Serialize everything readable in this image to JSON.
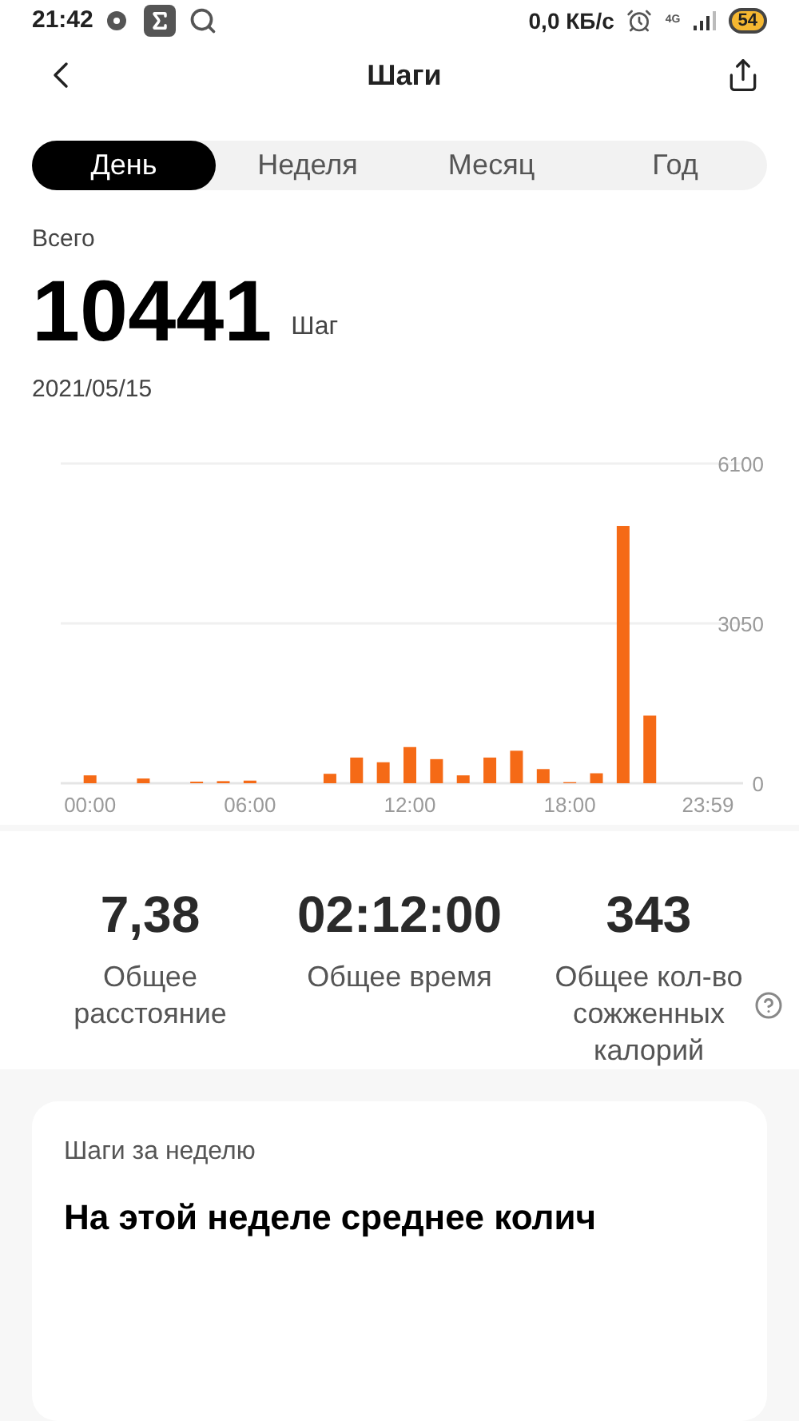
{
  "status_bar": {
    "time": "21:42",
    "speed": "0,0 КБ/с",
    "network": "4G",
    "battery": "54"
  },
  "header": {
    "title": "Шаги"
  },
  "tabs": [
    {
      "label": "День",
      "selected": true
    },
    {
      "label": "Неделя",
      "selected": false
    },
    {
      "label": "Месяц",
      "selected": false
    },
    {
      "label": "Год",
      "selected": false
    }
  ],
  "summary": {
    "label": "Всего",
    "value": "10441",
    "unit": "Шаг",
    "date": "2021/05/15"
  },
  "chart_data": {
    "type": "bar",
    "x": [
      0,
      1,
      2,
      3,
      4,
      5,
      6,
      7,
      8,
      9,
      10,
      11,
      12,
      13,
      14,
      15,
      16,
      17,
      18,
      19,
      20,
      21,
      22,
      23
    ],
    "xlim": [
      -1.1,
      24.5
    ],
    "series": [
      {
        "color": "#f56a16",
        "values": [
          150,
          0,
          90,
          0,
          30,
          40,
          50,
          0,
          0,
          180,
          490,
          400,
          690,
          460,
          150,
          490,
          620,
          270,
          20,
          190,
          4910,
          1290,
          0,
          0
        ]
      }
    ],
    "ylim": [
      0,
      6100
    ],
    "yticks": [
      0,
      3050,
      6100
    ],
    "xticks": [
      {
        "value": 0,
        "label": "00:00"
      },
      {
        "value": 6,
        "label": "06:00"
      },
      {
        "value": 12,
        "label": "12:00"
      },
      {
        "value": 18,
        "label": "18:00"
      },
      {
        "value": 23.98,
        "label": "23:59"
      }
    ]
  },
  "stats": [
    {
      "value": "7,38",
      "label": "Общее расстояние",
      "help": false
    },
    {
      "value": "02:12:00",
      "label": "Общее время",
      "help": false
    },
    {
      "value": "343",
      "label": "Общее кол-во сожженных калорий",
      "help": true
    }
  ],
  "week_card": {
    "label": "Шаги за неделю",
    "heading": "На этой неделе среднее колич"
  }
}
